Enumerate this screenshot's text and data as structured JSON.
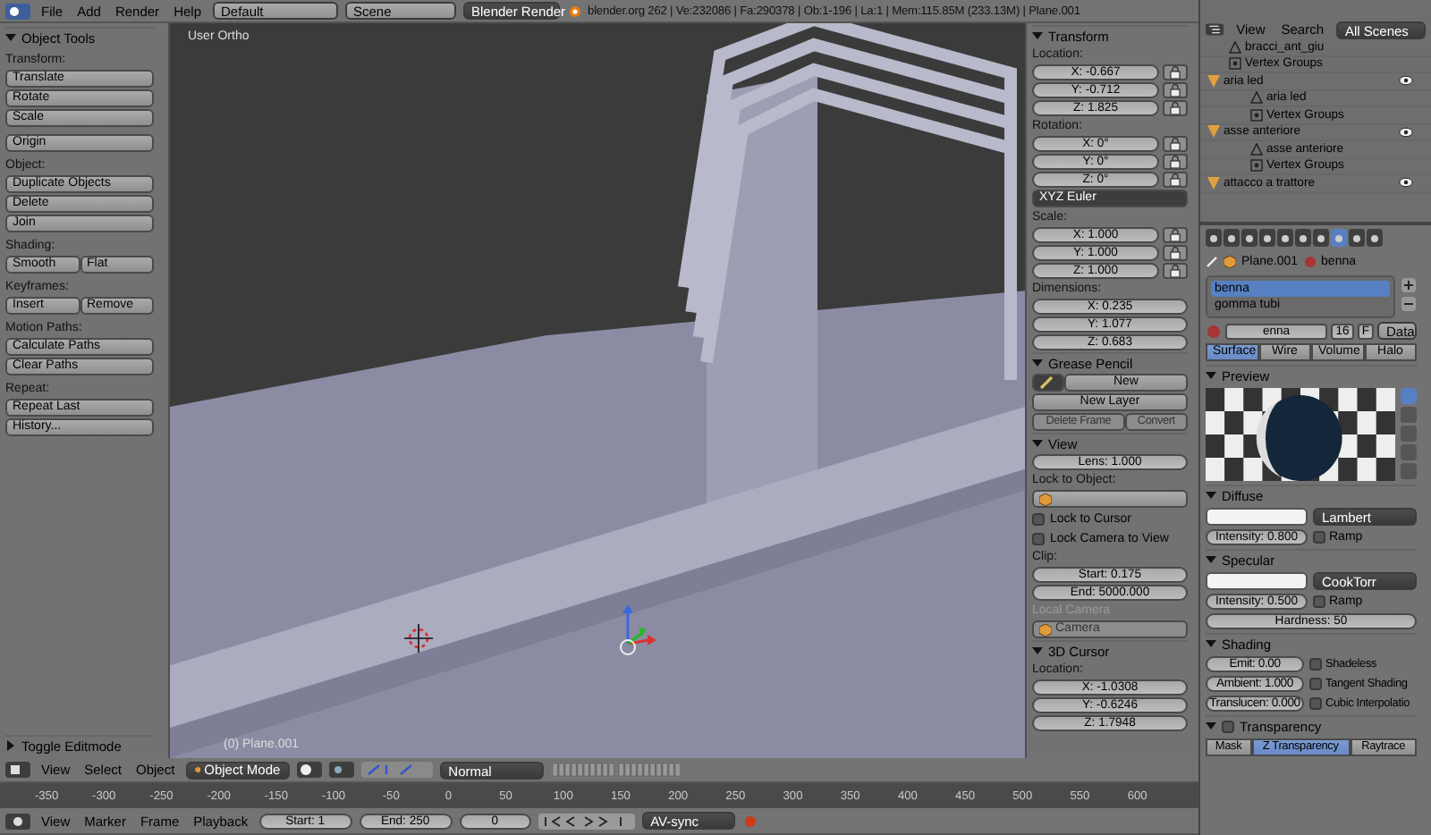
{
  "top_bar": {
    "menus": [
      "File",
      "Add",
      "Render",
      "Help"
    ],
    "layout": "Default",
    "scene": "Scene",
    "engine": "Blender Render",
    "stats": "blender.org 262 | Ve:232086 | Fa:290378 | Ob:1-196 | La:1 | Mem:115.85M (233.13M) | Plane.001"
  },
  "tool_shelf": {
    "title": "Object Tools",
    "expanded": true,
    "groups": [
      {
        "label": "Transform:",
        "rows": [
          [
            "Translate"
          ],
          [
            "Rotate"
          ],
          [
            "Scale"
          ]
        ]
      },
      {
        "rows": [
          [
            "Origin"
          ]
        ]
      },
      {
        "label": "Object:",
        "rows": [
          [
            "Duplicate Objects"
          ],
          [
            "Delete"
          ],
          [
            "Join"
          ]
        ]
      },
      {
        "label": "Shading:",
        "rows": [
          [
            "Smooth",
            "Flat"
          ]
        ]
      },
      {
        "label": "Keyframes:",
        "rows": [
          [
            "Insert",
            "Remove"
          ]
        ]
      },
      {
        "label": "Motion Paths:",
        "rows": [
          [
            "Calculate Paths"
          ],
          [
            "Clear Paths"
          ]
        ]
      },
      {
        "label": "Repeat:",
        "rows": [
          [
            "Repeat Last"
          ],
          [
            "History..."
          ]
        ]
      }
    ],
    "collapsed_panel": {
      "title": "Toggle Editmode",
      "expanded": false
    }
  },
  "viewport": {
    "view_name": "User Ortho",
    "object_label": "(0) Plane.001"
  },
  "n_panel": {
    "panels": [
      {
        "title": "Transform",
        "expanded": true,
        "items": [
          {
            "kind": "label",
            "text": "Location:"
          },
          {
            "kind": "locked_field",
            "text": "X: -0.667"
          },
          {
            "kind": "locked_field",
            "text": "Y: -0.712"
          },
          {
            "kind": "locked_field",
            "text": "Z: 1.825"
          },
          {
            "kind": "label",
            "text": "Rotation:"
          },
          {
            "kind": "locked_field",
            "text": "X: 0°"
          },
          {
            "kind": "locked_field",
            "text": "Y: 0°"
          },
          {
            "kind": "locked_field",
            "text": "Z: 0°"
          },
          {
            "kind": "dropdown",
            "text": "XYZ Euler"
          },
          {
            "kind": "label",
            "text": "Scale:"
          },
          {
            "kind": "locked_field",
            "text": "X: 1.000"
          },
          {
            "kind": "locked_field",
            "text": "Y: 1.000"
          },
          {
            "kind": "locked_field",
            "text": "Z: 1.000"
          },
          {
            "kind": "label",
            "text": "Dimensions:"
          },
          {
            "kind": "field",
            "text": "X: 0.235"
          },
          {
            "kind": "field",
            "text": "Y: 1.077"
          },
          {
            "kind": "field",
            "text": "Z: 0.683"
          }
        ]
      },
      {
        "title": "Grease Pencil",
        "expanded": true,
        "items": [
          {
            "kind": "new_row",
            "text": "New"
          },
          {
            "kind": "button",
            "text": "New Layer"
          },
          {
            "kind": "buttons",
            "buttons": [
              {
                "text": "Delete Frame",
                "disabled": true
              },
              {
                "text": "Convert",
                "disabled": true
              }
            ]
          }
        ]
      },
      {
        "title": "View",
        "expanded": true,
        "items": [
          {
            "kind": "field",
            "text": "Lens: 1.000"
          },
          {
            "kind": "label",
            "text": "Lock to Object:"
          },
          {
            "kind": "object_field"
          },
          {
            "kind": "checkbox",
            "text": "Lock to Cursor",
            "checked": false
          },
          {
            "kind": "checkbox",
            "text": "Lock Camera to View",
            "checked": false
          },
          {
            "kind": "label",
            "text": "Clip:"
          },
          {
            "kind": "field",
            "text": "Start: 0.175"
          },
          {
            "kind": "field",
            "text": "End: 5000.000"
          },
          {
            "kind": "label",
            "text": "Local Camera",
            "disabled": true
          },
          {
            "kind": "object_field",
            "text": "Camera",
            "disabled": true
          }
        ]
      },
      {
        "title": "3D Cursor",
        "expanded": true,
        "items": [
          {
            "kind": "label",
            "text": "Location:"
          },
          {
            "kind": "field",
            "text": "X: -1.0308"
          },
          {
            "kind": "field",
            "text": "Y: -0.6246"
          },
          {
            "kind": "field",
            "text": "Z: 1.7948"
          }
        ]
      }
    ]
  },
  "outliner": {
    "menus": [
      "View",
      "Search"
    ],
    "scope": "All Scenes",
    "items": [
      {
        "kind": "mesh",
        "name": "bracci_ant_giu"
      },
      {
        "kind": "vertex_groups",
        "name": "Vertex Groups"
      },
      {
        "kind": "object",
        "name": "aria led",
        "children": [
          {
            "kind": "mesh",
            "name": "aria led"
          },
          {
            "kind": "vertex_groups",
            "name": "Vertex Groups"
          }
        ]
      },
      {
        "kind": "object",
        "name": "asse anteriore",
        "children": [
          {
            "kind": "mesh",
            "name": "asse anteriore"
          },
          {
            "kind": "vertex_groups",
            "name": "Vertex Groups"
          }
        ]
      },
      {
        "kind": "object",
        "name": "attacco a trattore"
      }
    ]
  },
  "properties": {
    "context_tabs": [
      {
        "selected": false
      },
      {
        "selected": false
      },
      {
        "selected": false
      },
      {
        "selected": false
      },
      {
        "selected": false
      },
      {
        "selected": false
      },
      {
        "selected": false
      },
      {
        "selected": true
      },
      {
        "selected": false
      },
      {
        "selected": false
      }
    ],
    "breadcrumb": [
      "Plane.001",
      "benna"
    ],
    "material_slots": [
      {
        "name": "benna",
        "selected": true
      },
      {
        "name": "gomma tubi",
        "selected": false
      }
    ],
    "material_name": "enna",
    "users": "16",
    "fake_user": "F",
    "link": "Data",
    "type_tabs": [
      {
        "label": "Surface",
        "selected": true
      },
      {
        "label": "Wire",
        "selected": false
      },
      {
        "label": "Volume",
        "selected": false
      },
      {
        "label": "Halo",
        "selected": false
      }
    ],
    "preview": {
      "title": "Preview",
      "expanded": true
    },
    "diffuse": {
      "title": "Diffuse",
      "expanded": true,
      "shader": "Lambert",
      "intensity": "Intensity: 0.800",
      "ramp": {
        "label": "Ramp",
        "checked": false
      }
    },
    "specular": {
      "title": "Specular",
      "expanded": true,
      "shader": "CookTorr",
      "intensity": "Intensity: 0.500",
      "ramp": {
        "label": "Ramp",
        "checked": false
      },
      "hardness": "Hardness: 50"
    },
    "shading": {
      "title": "Shading",
      "expanded": true,
      "fields": [
        "Emit: 0.00",
        "Ambient: 1.000",
        "Translucen: 0.000"
      ],
      "options": [
        {
          "label": "Shadeless",
          "checked": false
        },
        {
          "label": "Tangent Shading",
          "checked": false
        },
        {
          "label": "Cubic Interpolatio",
          "checked": false
        }
      ]
    },
    "transparency": {
      "title": "Transparency",
      "expanded": true,
      "enabled": false,
      "modes": [
        {
          "label": "Mask",
          "selected": false
        },
        {
          "label": "Z Transparency",
          "selected": true
        },
        {
          "label": "Raytrace",
          "selected": false
        }
      ]
    }
  },
  "view3d_header": {
    "menus": [
      "View",
      "Select",
      "Object"
    ],
    "mode": "Object Mode",
    "orientation": "Normal"
  },
  "timeline": {
    "ticks": [
      "-350",
      "-300",
      "-250",
      "-200",
      "-150",
      "-100",
      "-50",
      "0",
      "50",
      "100",
      "150",
      "200",
      "250",
      "300",
      "350",
      "400",
      "450",
      "500",
      "550",
      "600"
    ],
    "menus": [
      "View",
      "Marker",
      "Frame",
      "Playback"
    ],
    "start": "Start: 1",
    "end": "End: 250",
    "current": "0",
    "sync": "AV-sync"
  }
}
